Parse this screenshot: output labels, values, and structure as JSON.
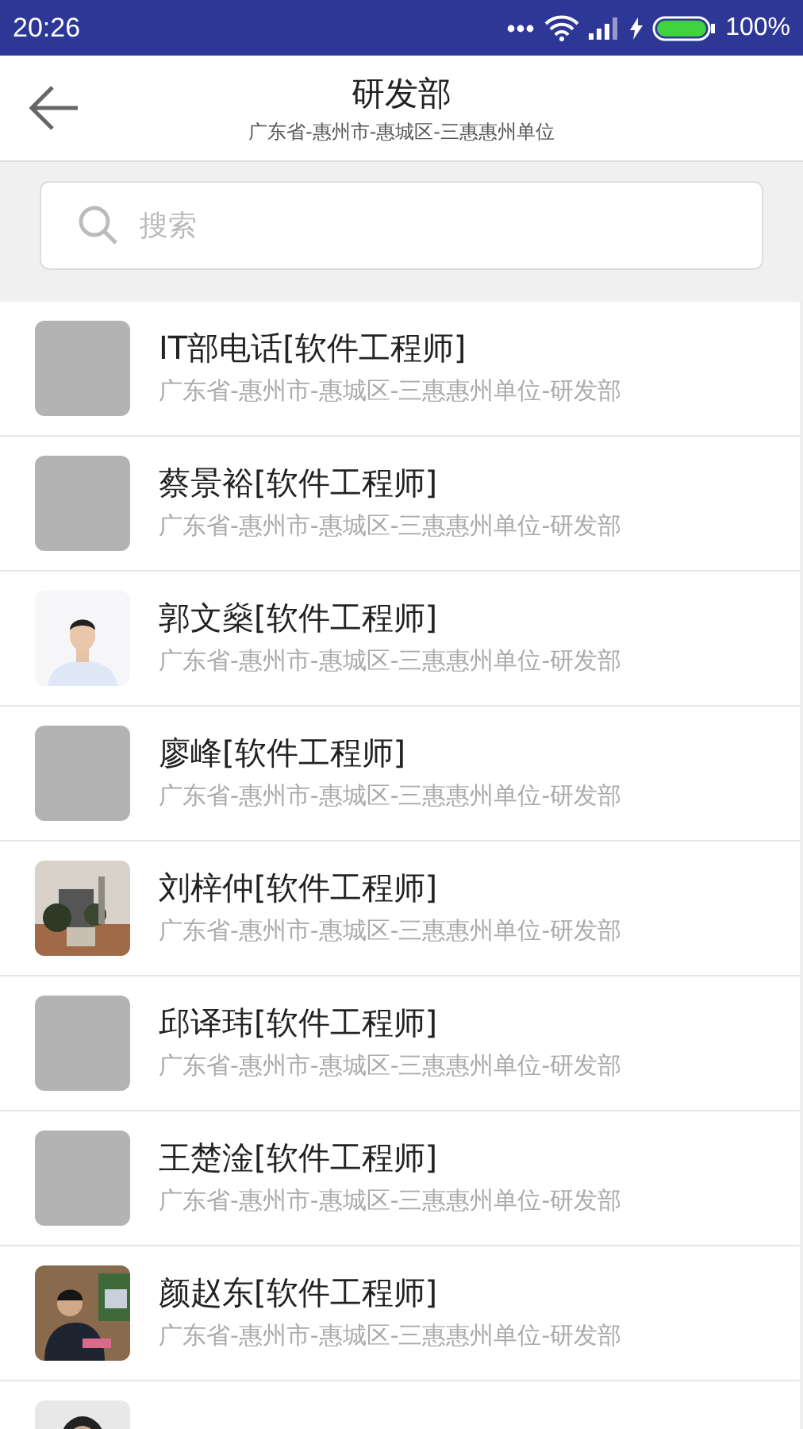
{
  "status_bar": {
    "time": "20:26",
    "battery": "100%"
  },
  "header": {
    "title": "研发部",
    "subtitle": "广东省-惠州市-惠城区-三惠惠州单位"
  },
  "search": {
    "placeholder": "搜索"
  },
  "contacts": [
    {
      "name": "IT部电话[软件工程师]",
      "path": "广东省-惠州市-惠城区-三惠惠州单位-研发部",
      "kind": "blank"
    },
    {
      "name": "蔡景裕[软件工程师]",
      "path": "广东省-惠州市-惠城区-三惠惠州单位-研发部",
      "kind": "blank"
    },
    {
      "name": "郭文燊[软件工程师]",
      "path": "广东省-惠州市-惠城区-三惠惠州单位-研发部",
      "kind": "picture"
    },
    {
      "name": "廖峰[软件工程师]",
      "path": "广东省-惠州市-惠城区-三惠惠州单位-研发部",
      "kind": "blank"
    },
    {
      "name": "刘梓仲[软件工程师]",
      "path": "广东省-惠州市-惠城区-三惠惠州单位-研发部",
      "kind": "picture"
    },
    {
      "name": "邱译玮[软件工程师]",
      "path": "广东省-惠州市-惠城区-三惠惠州单位-研发部",
      "kind": "blank"
    },
    {
      "name": "王楚淦[软件工程师]",
      "path": "广东省-惠州市-惠城区-三惠惠州单位-研发部",
      "kind": "blank"
    },
    {
      "name": "颜赵东[软件工程师]",
      "path": "广东省-惠州市-惠城区-三惠惠州单位-研发部",
      "kind": "picture"
    },
    {
      "kind": "picture"
    }
  ]
}
